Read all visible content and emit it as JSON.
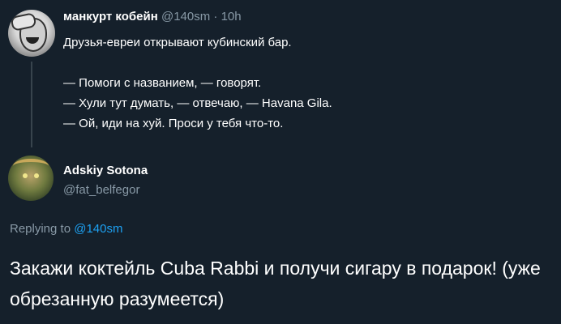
{
  "parent_tweet": {
    "name": "манкурт кобейн",
    "handle": "@140sm",
    "separator": "·",
    "time": "10h",
    "lines": [
      "Друзья-евреи открывают кубинский бар.",
      "",
      "— Помоги с названием, — говорят.",
      "— Хули тут думать, — отвечаю, — Havana Gila.",
      "— Ой, иди на хуй. Проси у тебя что-то."
    ]
  },
  "reply_tweet": {
    "name": "Adskiy Sotona",
    "handle": "@fat_belfegor",
    "replying_prefix": "Replying to",
    "replying_to": "@140sm",
    "text": "Закажи коктейль Cuba Rabbi и получи сигару в подарок! (уже обрезанную разумеется)"
  },
  "colors": {
    "background": "#15202b",
    "text": "#ffffff",
    "secondary": "#8899a6",
    "link": "#1da1f2",
    "thread_line": "#38444d"
  }
}
